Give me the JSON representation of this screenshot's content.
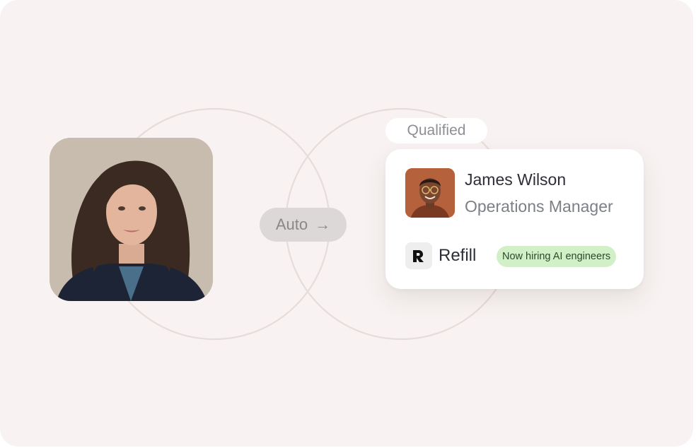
{
  "flow": {
    "auto_label": "Auto",
    "arrow_glyph": "→",
    "stage_label": "Qualified"
  },
  "profile": {
    "name": "James Wilson",
    "role": "Operations Manager",
    "company": "Refill",
    "badge": "Now hiring AI engineers"
  },
  "colors": {
    "background": "#f8f3f2",
    "badge_bg": "#d2f0c8",
    "pill_bg": "#dcd8d7"
  }
}
